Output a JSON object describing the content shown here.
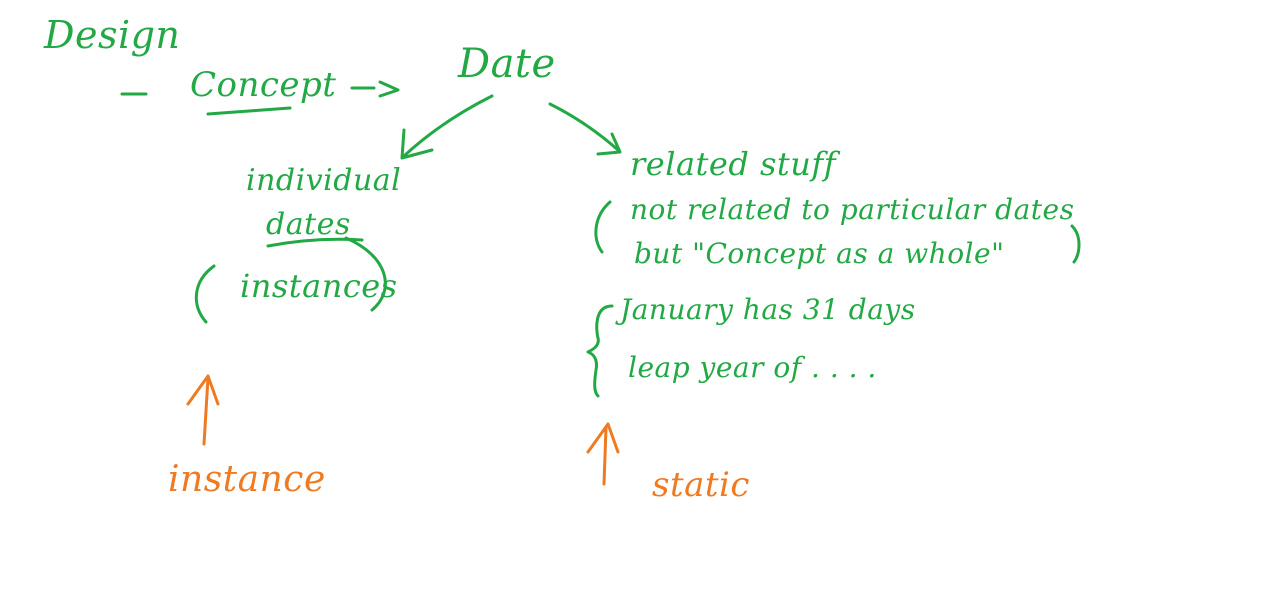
{
  "colors": {
    "ink_green": "#22a845",
    "ink_orange": "#f07a22",
    "background": "#ffffff"
  },
  "labels": {
    "title": "Design",
    "concept": "Concept",
    "date": "Date",
    "individual_dates_line1": "individual",
    "individual_dates_line2": "dates",
    "instances": "instances",
    "related_stuff": "related stuff",
    "not_related_line": "not related to particular dates",
    "concept_as_whole_line": "but \"Concept as a whole\"",
    "january_note": "January has 31 days",
    "leap_year_note": "leap year of . . . .",
    "instance_label": "instance",
    "static_label": "static"
  }
}
